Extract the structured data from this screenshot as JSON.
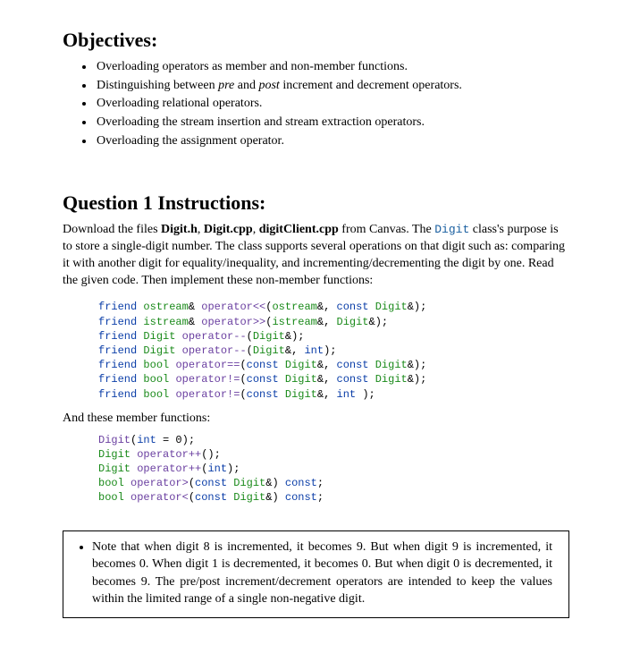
{
  "objectives": {
    "title": "Objectives:",
    "items": [
      {
        "prefix": "Overloading operators as member and non-member functions.",
        "pre": "",
        "post": ""
      },
      {
        "prefix": "Distinguishing between ",
        "pre": "pre",
        "mid": " and ",
        "post_italic": "post",
        "suffix": " increment and decrement operators."
      },
      {
        "prefix": "Overloading relational operators."
      },
      {
        "prefix": "Overloading the stream insertion and stream extraction operators."
      },
      {
        "prefix": "Overloading the assignment operator."
      }
    ]
  },
  "question": {
    "title": "Question 1 Instructions:",
    "intro1": "Download the files ",
    "file1": "Digit.h",
    "sep1": ", ",
    "file2": "Digit.cpp",
    "sep2": ", ",
    "file3": "digitClient.cpp",
    "intro2": " from Canvas.  The ",
    "class_name": "Digit",
    "intro3": " class's purpose is to store a single-digit number.  The class supports several operations on that digit such as: comparing it with another digit for equality/inequality, and incrementing/decrementing the digit by one.  Read the given code.  Then implement these non-member functions:"
  },
  "code_nonmember": [
    {
      "kw1": "friend",
      "typ1": "ostream",
      "amp1": "&",
      "id": "operator<<",
      "op": "(",
      "typ2": "ostream",
      "amp2": "&,",
      "kw2": "const",
      "typ3": "Digit",
      "amp3": "&);"
    },
    {
      "kw1": "friend",
      "typ1": "istream",
      "amp1": "&",
      "id": "operator>>",
      "op": "(",
      "typ2": "istream",
      "amp2": "&,",
      "kw2": "",
      "typ3": "Digit",
      "amp3": "&);"
    },
    {
      "kw1": "friend",
      "typ1": "Digit",
      "amp1": "",
      "id": "operator--",
      "op": "(",
      "typ2": "Digit",
      "amp2": "&);",
      "kw2": "",
      "typ3": "",
      "amp3": ""
    },
    {
      "kw1": "friend",
      "typ1": "Digit",
      "amp1": "",
      "id": "operator--",
      "op": "(",
      "typ2": "Digit",
      "amp2": "&,",
      "kw2": "int",
      "typ3": "",
      "amp3": ");"
    },
    {
      "kw1": "friend",
      "typ1": "bool",
      "amp1": "",
      "id": "operator==",
      "op": "(",
      "typ2": "",
      "amp2": "",
      "kw2": "const",
      "typ3": "Digit",
      "amp3": "&,",
      "kw3": "const",
      "typ4": "Digit",
      "amp4": "&);"
    },
    {
      "kw1": "friend",
      "typ1": "bool",
      "amp1": "",
      "id": "operator!=",
      "op": "(",
      "typ2": "",
      "amp2": "",
      "kw2": "const",
      "typ3": "Digit",
      "amp3": "&,",
      "kw3": "const",
      "typ4": "Digit",
      "amp4": "&);"
    },
    {
      "kw1": "friend",
      "typ1": "bool",
      "amp1": "",
      "id": "operator!=",
      "op": "(",
      "typ2": "",
      "amp2": "",
      "kw2": "const",
      "typ3": "Digit",
      "amp3": "&,",
      "kw3": "int",
      "typ4": "",
      "amp4": ");"
    }
  ],
  "member_head": "And these member functions:",
  "code_member": [
    {
      "id": "Digit",
      "op": "(",
      "kw": "int",
      "rest": " = 0);"
    },
    {
      "typ": "Digit",
      "id": "operator++",
      "op": "();",
      "kw": "",
      "rest": ""
    },
    {
      "typ": "Digit",
      "id": "operator++",
      "op": "(",
      "kw": "int",
      "rest": ");"
    },
    {
      "typ": "bool",
      "id": "operator>",
      "op": "(",
      "kw": "const",
      "typ2": "Digit",
      "rest": "&) ",
      "kw2": "const",
      "end": ";"
    },
    {
      "typ": "bool",
      "id": "operator<",
      "op": "(",
      "kw": "const",
      "typ2": "Digit",
      "rest": "&) ",
      "kw2": "const",
      "end": ";"
    }
  ],
  "note": "Note that when digit 8 is incremented, it becomes 9.  But when digit 9 is incremented, it becomes 0.  When digit 1 is decremented, it becomes 0.  But when digit 0 is decremented, it becomes 9.  The pre/post increment/decrement operators are intended to keep the values within the limited range of a single non-negative digit.",
  "chart_data": null
}
